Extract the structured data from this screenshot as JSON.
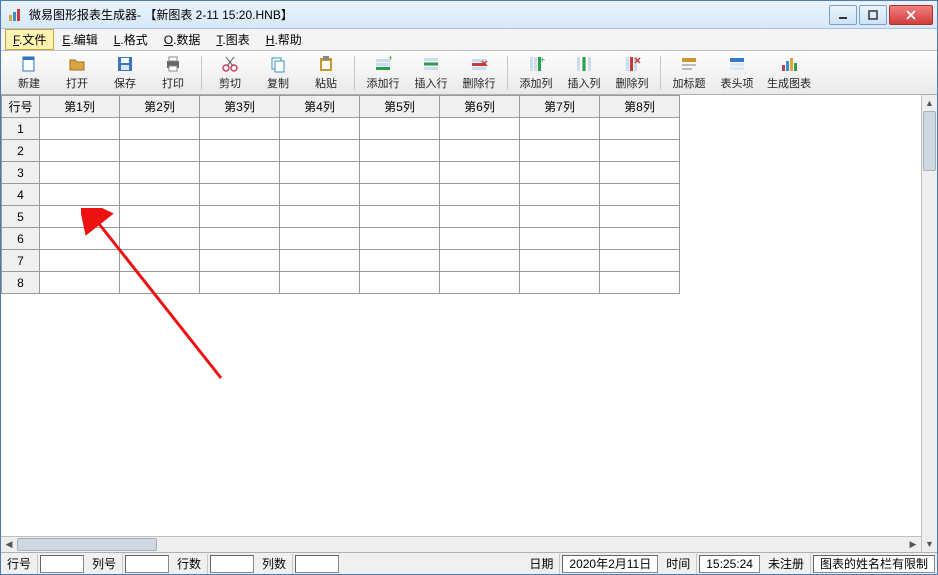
{
  "title": "微易图形报表生成器- 【新图表 2-11 15:20.HNB】",
  "menu": {
    "items": [
      {
        "key": "F",
        "label": "文件",
        "accel": "F"
      },
      {
        "key": "E",
        "label": "编辑",
        "accel": "E"
      },
      {
        "key": "L",
        "label": "格式",
        "accel": "L"
      },
      {
        "key": "O",
        "label": "数据",
        "accel": "O"
      },
      {
        "key": "T",
        "label": "图表",
        "accel": "T"
      },
      {
        "key": "H",
        "label": "帮助",
        "accel": "H"
      }
    ],
    "active_index": 0
  },
  "toolbar": {
    "groups": [
      [
        "新建",
        "打开",
        "保存",
        "打印"
      ],
      [
        "剪切",
        "复制",
        "粘贴"
      ],
      [
        "添加行",
        "插入行",
        "删除行"
      ],
      [
        "添加列",
        "插入列",
        "删除列"
      ],
      [
        "加标题",
        "表头项",
        "生成图表"
      ]
    ]
  },
  "table": {
    "rowhead_label": "行号",
    "col_labels": [
      "第1列",
      "第2列",
      "第3列",
      "第4列",
      "第5列",
      "第6列",
      "第7列",
      "第8列"
    ],
    "row_labels": [
      "1",
      "2",
      "3",
      "4",
      "5",
      "6",
      "7",
      "8"
    ],
    "cells": [
      [
        "",
        "",
        "",
        "",
        "",
        "",
        "",
        ""
      ],
      [
        "",
        "",
        "",
        "",
        "",
        "",
        "",
        ""
      ],
      [
        "",
        "",
        "",
        "",
        "",
        "",
        "",
        ""
      ],
      [
        "",
        "",
        "",
        "",
        "",
        "",
        "",
        ""
      ],
      [
        "",
        "",
        "",
        "",
        "",
        "",
        "",
        ""
      ],
      [
        "",
        "",
        "",
        "",
        "",
        "",
        "",
        ""
      ],
      [
        "",
        "",
        "",
        "",
        "",
        "",
        "",
        ""
      ],
      [
        "",
        "",
        "",
        "",
        "",
        "",
        "",
        ""
      ]
    ]
  },
  "status": {
    "row_label": "行号",
    "row_value": "",
    "col_label": "列号",
    "col_value": "",
    "rows_label": "行数",
    "rows_value": "",
    "cols_label": "列数",
    "cols_value": "",
    "date_label": "日期",
    "date_value": "2020年2月11日",
    "time_label": "时间",
    "time_value": "15:25:24",
    "reg_status": "未注册",
    "note": "图表的姓名栏有限制"
  },
  "icons": {
    "new": "#2b74c7",
    "open": "#d9a441",
    "save": "#3a77c2",
    "print": "#666",
    "cut": "#d04060",
    "copy": "#3a90c2",
    "paste": "#c79a30",
    "addrow": "#2a9d4a",
    "insrow": "#2a9d4a",
    "delrow": "#c73a3a",
    "addcol": "#2a9d4a",
    "inscol": "#2a9d4a",
    "delcol": "#c73a3a",
    "title": "#c79a30",
    "header": "#3a77c2",
    "chart": "#b04070"
  }
}
